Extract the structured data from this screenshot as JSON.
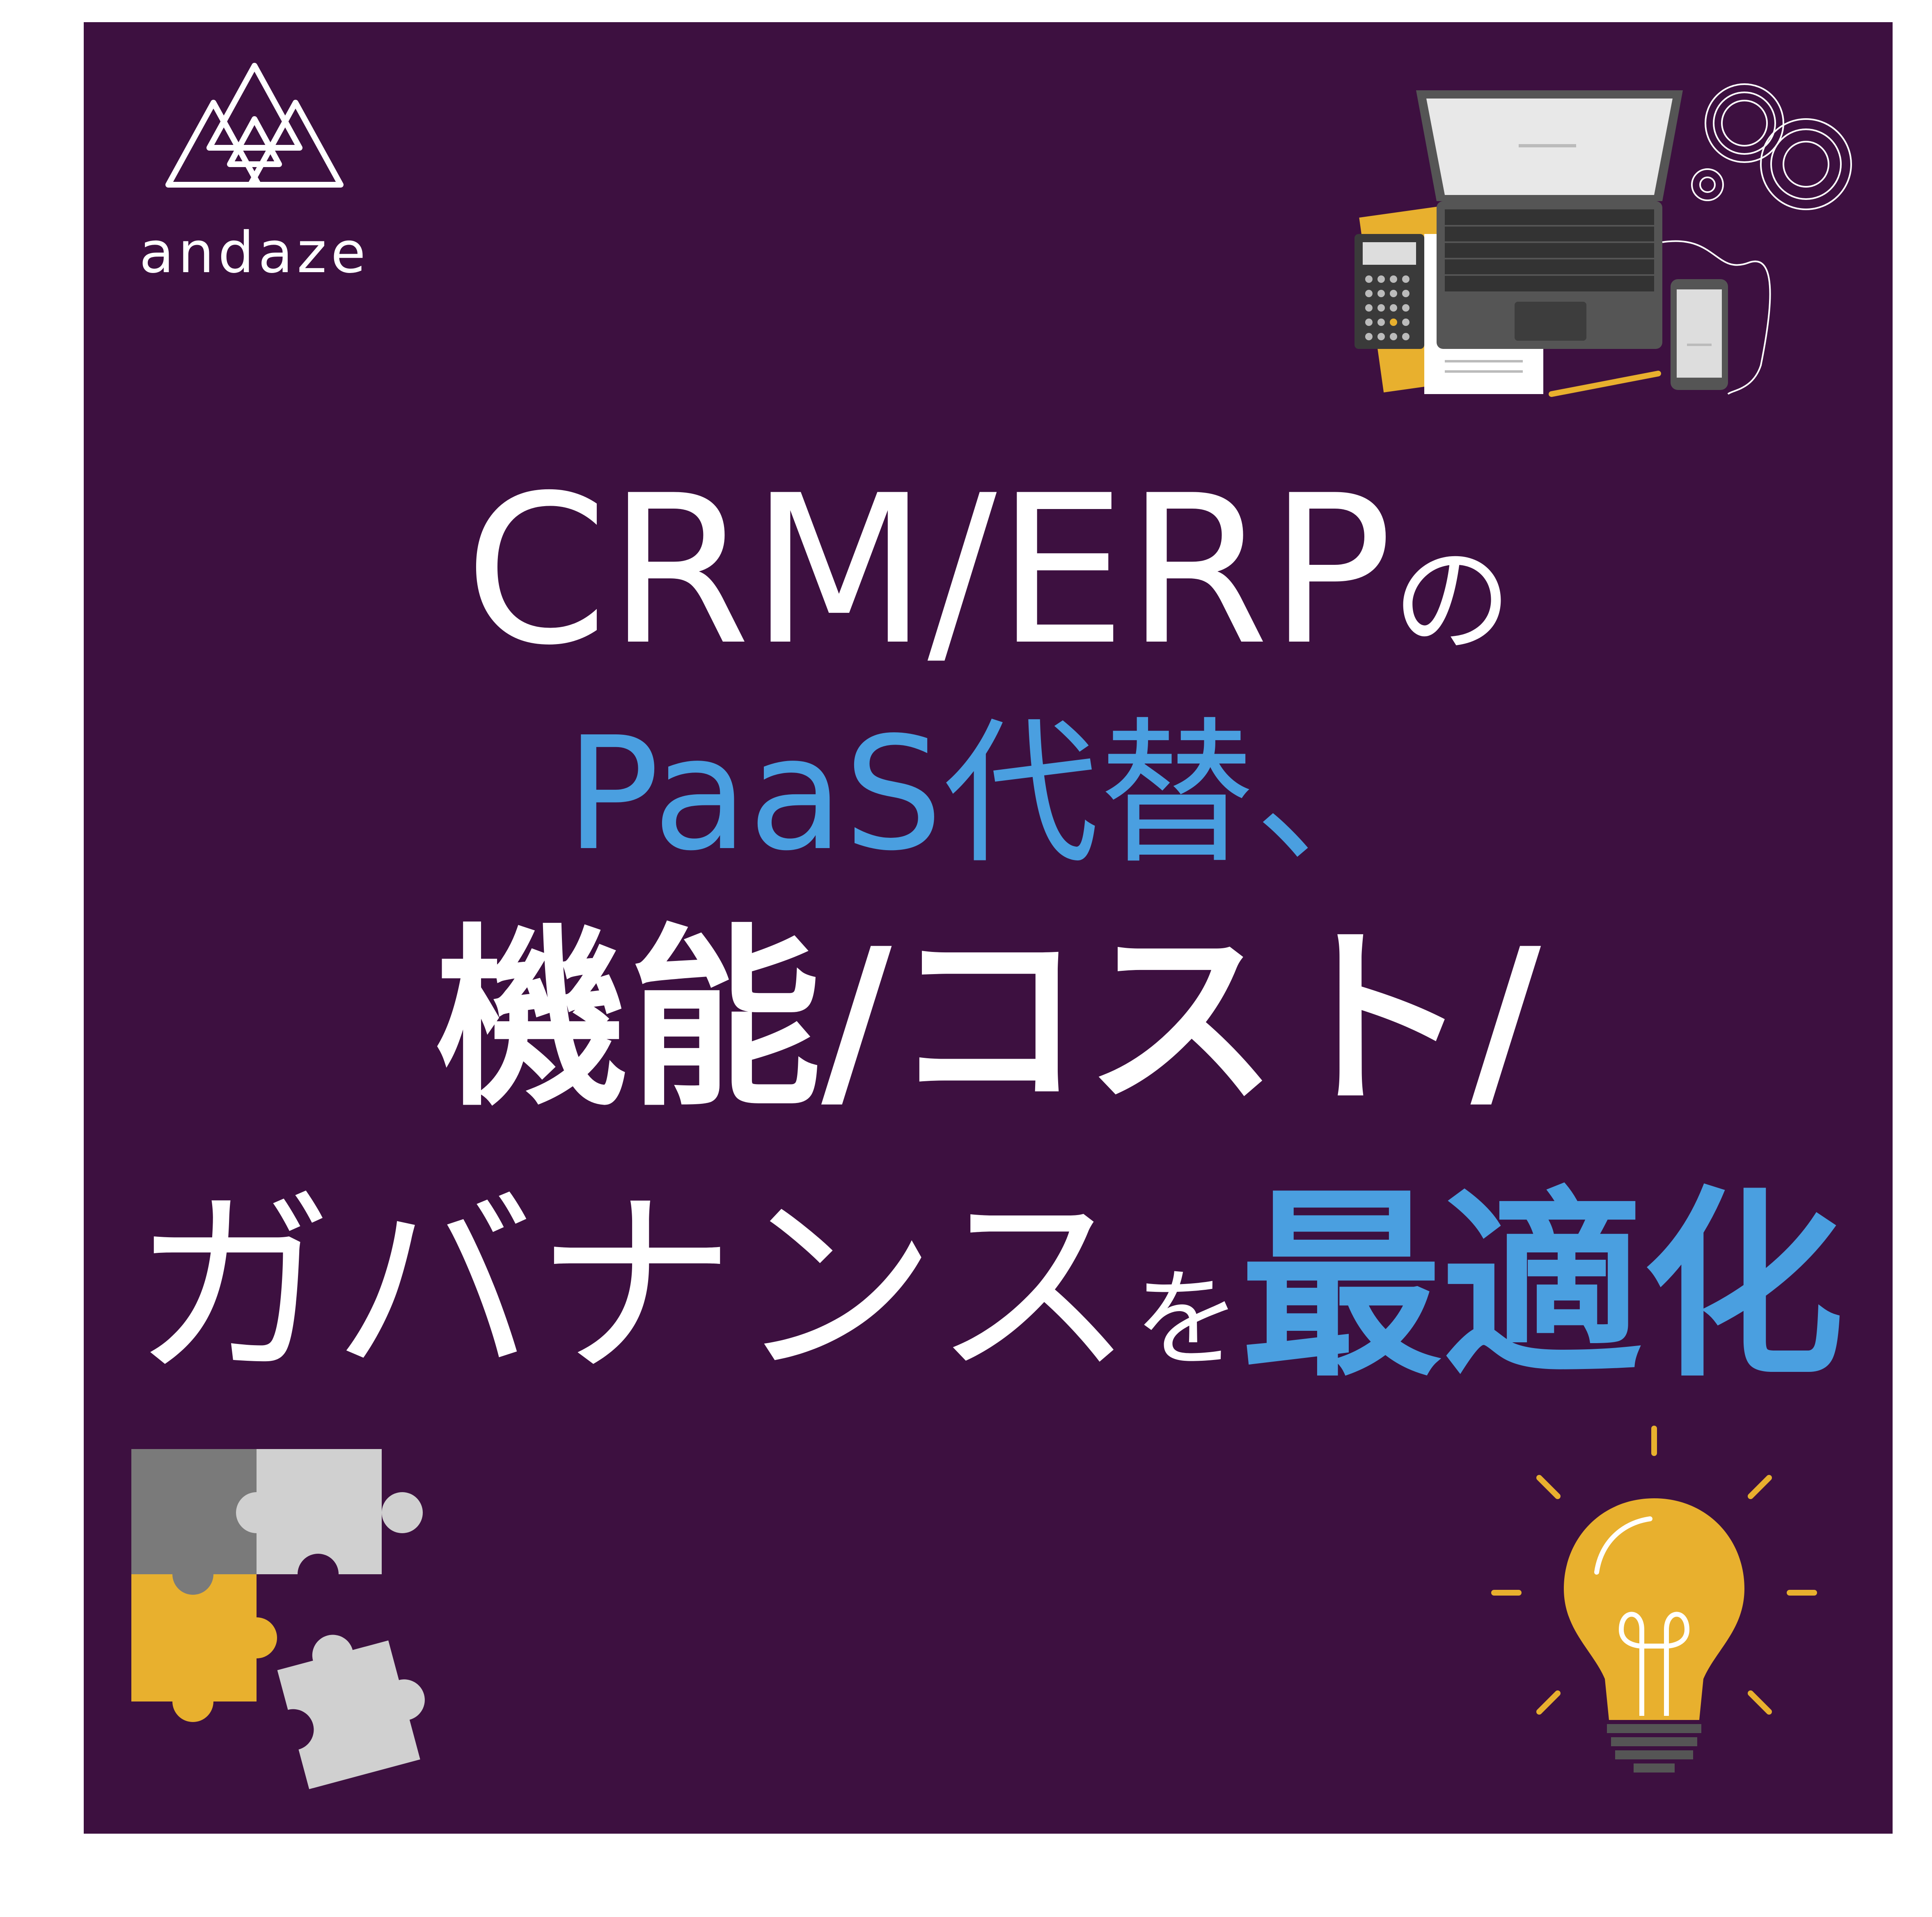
{
  "logo": {
    "text": "andaze",
    "icon": "triangle-knot-logo"
  },
  "headline": {
    "line1_main": "CRM/ERP",
    "line1_suffix": "の",
    "line2": "PaaS代替、",
    "line3": "機能/コスト/",
    "line4_main": "ガバナンス",
    "line4_particle": "を",
    "line4_highlight": "最適化"
  },
  "colors": {
    "background": "#3d1040",
    "accent_blue": "#4a9fe0",
    "text": "#ffffff",
    "accent_yellow": "#e8b02e"
  },
  "illustrations": {
    "top_right": "laptop-desk-icon",
    "bottom_left": "puzzle-pieces-icon",
    "bottom_right": "lightbulb-icon"
  }
}
